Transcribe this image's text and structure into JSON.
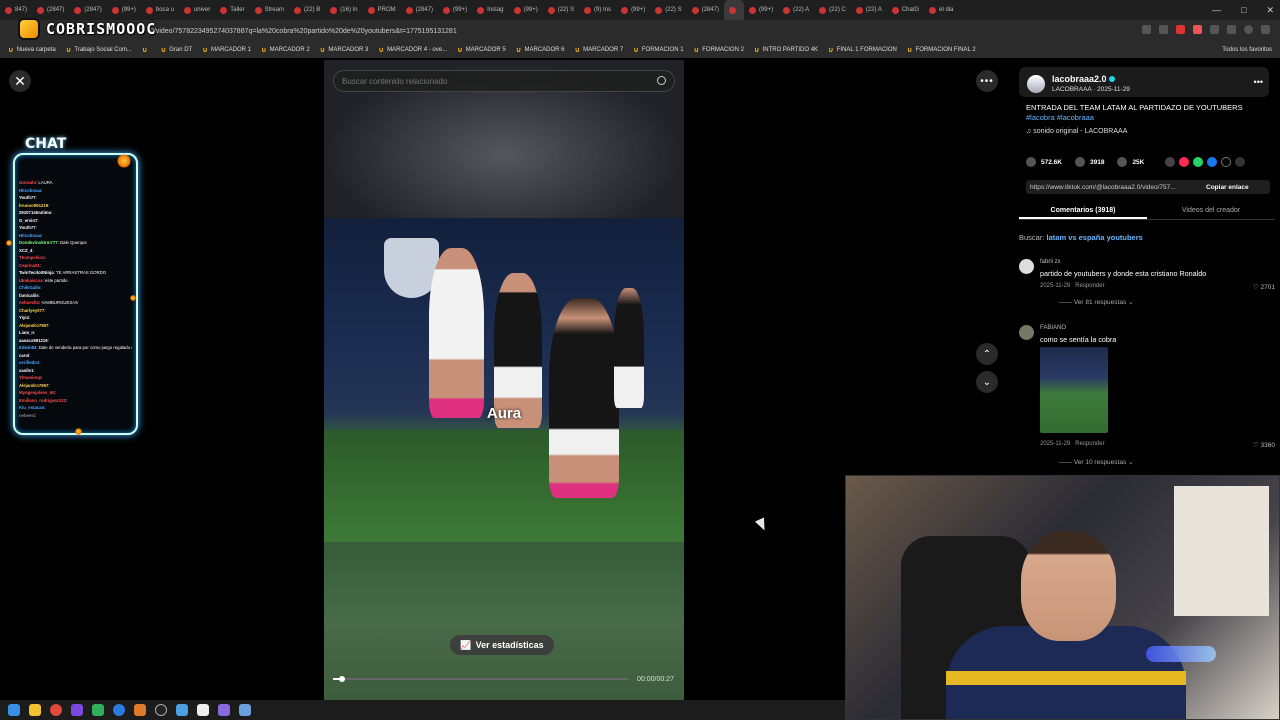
{
  "browser": {
    "tabs": [
      "847)",
      "(2847)",
      "(2847)",
      "(99+)",
      "boca u",
      "univer",
      "Taller",
      "Stream",
      "(22) B",
      "(16) In",
      "PROM",
      "(2847)",
      "(99+)",
      "Instag",
      "(99+)",
      "(22) S",
      "(9) Ins",
      "(99+)",
      "(22) S",
      "(2847)",
      "",
      "(99+)",
      "(22) A",
      "(22) C",
      "(22) A",
      "ChatG",
      "el dia"
    ],
    "active_tab_index": 20,
    "url": "0/video/7578223495274037887q=la%20cobra%20partido%20de%20youtubers&t=1775195131281",
    "bookmarks": [
      "Nueva carpeta",
      "Trabajo Social Com...",
      "",
      "Gran DT",
      "MARCADOR 1",
      "MARCADOR 2",
      "MARCADOR 3",
      "MARCADOR 4 - ove...",
      "MARCADOR 5",
      "MARCADOR 6",
      "MARCADOR 7",
      "FORMACION 1",
      "FORMACION 2",
      "INTRO PARTIDO 4K",
      "FINAL 1 FORMACION",
      "FORMACION FINAL 2"
    ],
    "bookmarks_right": "Todos los favoritos"
  },
  "stream_overlay": {
    "channel_logo_text": "COBRISMOOOC",
    "chat_title": "CHAT",
    "chat_lines": [
      {
        "user": "Gonzalo",
        "msg": "LAURA",
        "color": "#ff4d4d"
      },
      {
        "user": "Hitcobraaa",
        "msg": "",
        "color": "#4da6ff"
      },
      {
        "user": "Youth77",
        "msg": "",
        "color": "#ffffff"
      },
      {
        "user": "brunoo991219",
        "msg": "",
        "color": "#ffd84d"
      },
      {
        "user": "2910714Inutimo",
        "msg": "",
        "color": "#ffffff"
      },
      {
        "user": "G_ervin7",
        "msg": "",
        "color": "#ffffff"
      },
      {
        "user": "Youth77",
        "msg": "",
        "color": "#ffffff"
      },
      {
        "user": "Hitcobraaa",
        "msg": "",
        "color": "#4da6ff"
      },
      {
        "user": "Dondevinoktrm777",
        "msg": "Dale Querque",
        "color": "#7dff7d"
      },
      {
        "user": "XCZ_4",
        "msg": "",
        "color": "#ffffff"
      },
      {
        "user": "Thompchico",
        "msg": "",
        "color": "#ff4d4d"
      },
      {
        "user": "Ceprina01",
        "msg": "",
        "color": "#ff4d4d"
      },
      {
        "user": "TwinTecito0Ninja",
        "msg": "TE ARRASTRAS GORDO",
        "color": "#ffffff"
      },
      {
        "user": "Ukokaiscxa",
        "msg": "este partido",
        "color": "#ff4d4d"
      },
      {
        "user": "ChikiGallo",
        "msg": "",
        "color": "#4da6ff"
      },
      {
        "user": "famicaliis",
        "msg": "",
        "color": "#ffffff"
      },
      {
        "user": "nehuecllo",
        "msg": "HAMBURGUESAS",
        "color": "#ff4d4d"
      },
      {
        "user": "Charlyey077",
        "msg": "",
        "color": "#ffd84d"
      },
      {
        "user": "Yiyi4",
        "msg": "",
        "color": "#ffffff"
      },
      {
        "user": "Alejandro7997",
        "msg": "",
        "color": "#ffd84d"
      },
      {
        "user": "Liam_n",
        "msg": "",
        "color": "#ffffff"
      },
      {
        "user": "aasacx991219",
        "msg": "",
        "color": "#ffffff"
      },
      {
        "user": "Edwin84",
        "msg": "Dale de vendería para por como juego regalado en",
        "color": "#4da6ff"
      },
      {
        "user": "carol",
        "msg": "",
        "color": "#ffffff"
      },
      {
        "user": "verifiedo1",
        "msg": "",
        "color": "#4da6ff"
      },
      {
        "user": "xasile1",
        "msg": "",
        "color": "#ffffff"
      },
      {
        "user": "Yfmanioop",
        "msg": "",
        "color": "#ff4d4d"
      },
      {
        "user": "Alejandro7997",
        "msg": "",
        "color": "#ffd84d"
      },
      {
        "user": "Myogenjalseo_60",
        "msg": "",
        "color": "#ff4d4d"
      },
      {
        "user": "Emiliano_rodriguez123",
        "msg": "",
        "color": "#ff4d4d"
      },
      {
        "user": "Kiu_estacan",
        "msg": "",
        "color": "#4da6ff"
      },
      {
        "user": "nebeesi",
        "msg": "",
        "color": "#888888"
      }
    ]
  },
  "video": {
    "search_placeholder": "Buscar contenido relacionado",
    "caption_overlay": "Aura",
    "stats_button": "Ver estadísticas",
    "timecode": "00:00/00:27",
    "progress": 0.03
  },
  "post": {
    "author_name": "lacobraaa2.0",
    "author_sub": "LACOBRAAA · 2025-11-29",
    "description": "ENTRADA DEL TEAM LATAM AL PARTIDAZO DE YOUTUBERS",
    "hashtags": "#lacobra #lacobraaa",
    "sound": "sonido original - LACOBRAAA",
    "likes": "572.6K",
    "comments_count": "3918",
    "saves": "25K",
    "link_url": "https://www.tiktok.com/@lacobraaa2.0/video/757...",
    "copy_link": "Copiar enlace",
    "tab_comments": "Comentarios (3918)",
    "tab_creator": "Videos del creador",
    "search_label": "Buscar:",
    "search_suggestion": "latam vs españa youtubers"
  },
  "comments": [
    {
      "user": "fabrii  zx",
      "text": "partido de youtubers y donde esta cristiano Ronaldo",
      "date": "2025-11-29",
      "reply": "Responder",
      "likes": "2701",
      "replies": "Ver 81 respuestas"
    },
    {
      "user": "FABIANO",
      "text": "como se sentía la cobra",
      "date": "2025-11-29",
      "reply": "Responder",
      "likes": "3360",
      "replies": "Ver 10 respuestas"
    }
  ],
  "icons": {
    "close": "close-icon",
    "more": "more-icon",
    "up": "chevron-up-icon",
    "down": "chevron-down-icon",
    "search": "search-icon",
    "stats": "chart-icon"
  }
}
